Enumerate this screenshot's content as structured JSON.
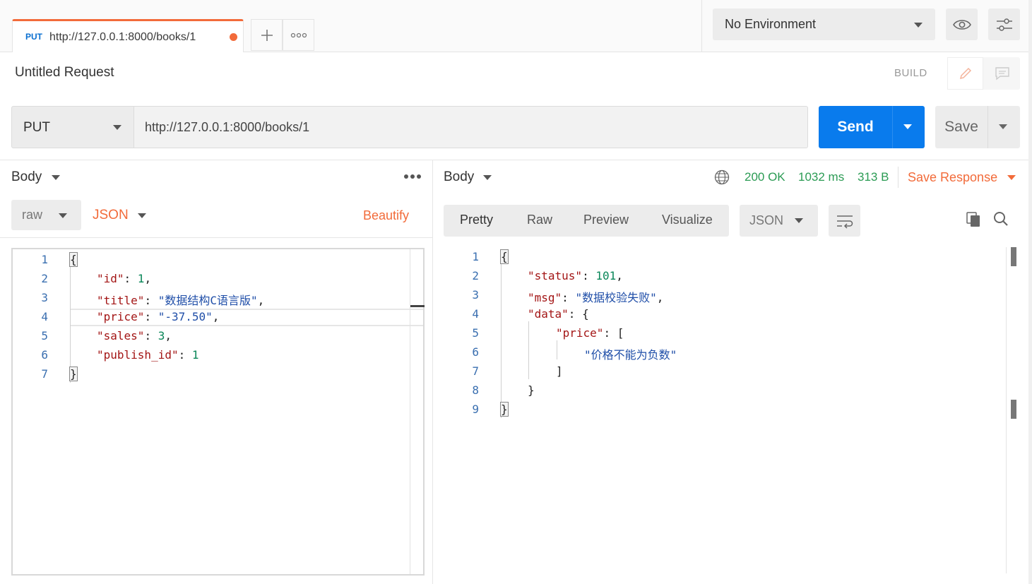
{
  "tab": {
    "method": "PUT",
    "url": "http://127.0.0.1:8000/books/1"
  },
  "environment": {
    "selected": "No Environment"
  },
  "request": {
    "name": "Untitled Request",
    "build_label": "BUILD"
  },
  "urlbar": {
    "method": "PUT",
    "url": "http://127.0.0.1:8000/books/1",
    "send_label": "Send",
    "save_label": "Save"
  },
  "left": {
    "title": "Body",
    "body_mode": "raw",
    "format": "JSON",
    "beautify_label": "Beautify",
    "line_numbers": [
      "1",
      "2",
      "3",
      "4",
      "5",
      "6",
      "7"
    ],
    "code": {
      "open": "{",
      "id_key": "\"id\"",
      "id_val": "1",
      "title_key": "\"title\"",
      "title_val": "\"数据结构C语言版\"",
      "price_key": "\"price\"",
      "price_val": "\"-37.50\"",
      "sales_key": "\"sales\"",
      "sales_val": "3",
      "publish_key": "\"publish_id\"",
      "publish_val": "1",
      "close": "}"
    }
  },
  "right": {
    "title": "Body",
    "status": "200 OK",
    "time": "1032 ms",
    "size": "313 B",
    "save_response_label": "Save Response",
    "view_tabs": [
      "Pretty",
      "Raw",
      "Preview",
      "Visualize"
    ],
    "format": "JSON",
    "line_numbers": [
      "1",
      "2",
      "3",
      "4",
      "5",
      "6",
      "7",
      "8",
      "9"
    ],
    "code": {
      "open": "{",
      "status_key": "\"status\"",
      "status_val": "101",
      "msg_key": "\"msg\"",
      "msg_val": "\"数据校验失败\"",
      "data_key": "\"data\"",
      "price_key": "\"price\"",
      "price_msg": "\"价格不能为负数\"",
      "arr_close": "]",
      "obj_close": "}",
      "close": "}"
    }
  },
  "colors": {
    "accent": "#f26b3a",
    "send": "#097bed",
    "ok": "#2b9b54"
  },
  "icons": [
    "plus-icon",
    "more-icon",
    "eye-icon",
    "sliders-icon",
    "pencil-icon",
    "comment-icon",
    "globe-icon",
    "wrap-icon",
    "copy-icon",
    "search-icon"
  ]
}
